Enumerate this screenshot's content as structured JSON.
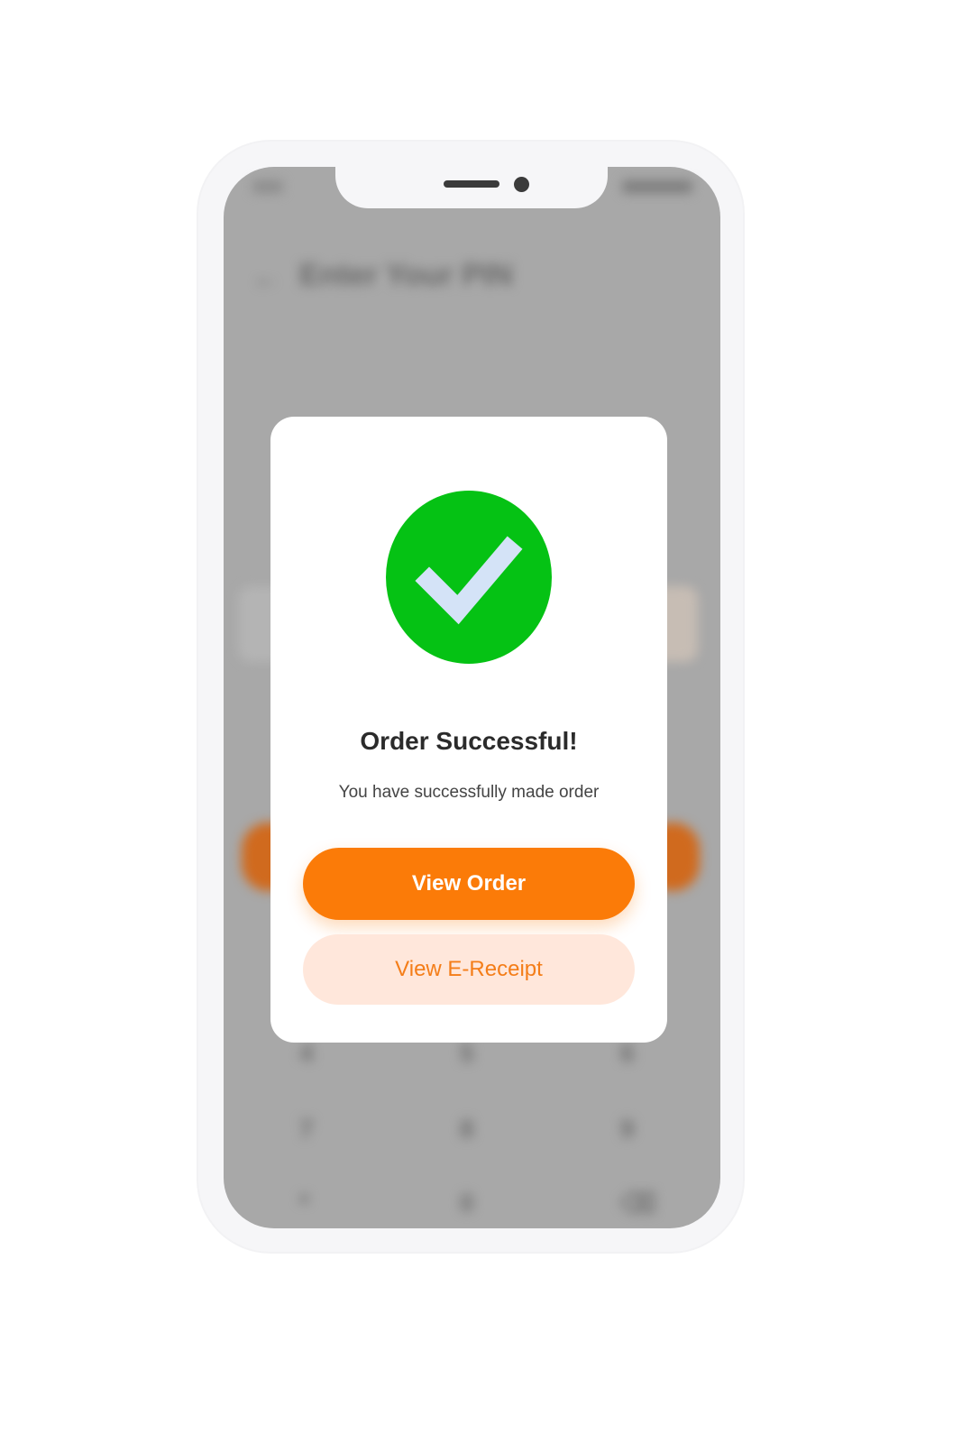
{
  "background_screen": {
    "header_title": "Enter Your PIN",
    "back_icon": "arrow-left-icon",
    "keypad_rows": [
      [
        "4",
        "5",
        "6"
      ],
      [
        "7",
        "8",
        "9"
      ],
      [
        "*",
        "0",
        "⌫"
      ]
    ]
  },
  "modal": {
    "icon": "check-circle-icon",
    "title": "Order Successful!",
    "subtitle": "You have successfully made order",
    "primary_button_label": "View Order",
    "secondary_button_label": "View E-Receipt"
  },
  "colors": {
    "accent": "#fb7b08",
    "success": "#05c214",
    "secondary_button_bg": "#ffe7db",
    "overlay": "#a8a8a8"
  }
}
